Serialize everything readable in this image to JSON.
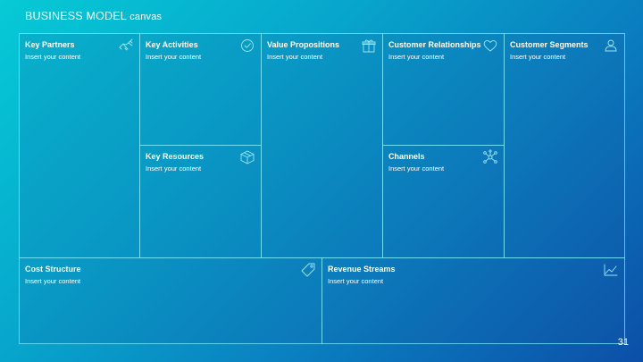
{
  "slide": {
    "title_main": "BUSINESS MODEL",
    "title_rest": " canvas",
    "page_number": "31"
  },
  "cells": {
    "key_partners": {
      "title": "Key Partners",
      "subtitle": "Insert your content",
      "icon": "handshake-icon"
    },
    "key_activities": {
      "title": "Key Activities",
      "subtitle": "Insert your content",
      "icon": "checkmark-icon"
    },
    "key_resources": {
      "title": "Key Resources",
      "subtitle": "Insert your content",
      "icon": "box-icon"
    },
    "value_propositions": {
      "title": "Value Propositions",
      "subtitle": "Insert your content",
      "icon": "gift-icon"
    },
    "customer_relationships": {
      "title": "Customer Relationships",
      "subtitle": "Insert your content",
      "icon": "heart-icon"
    },
    "channels": {
      "title": "Channels",
      "subtitle": "Insert your content",
      "icon": "network-icon"
    },
    "customer_segments": {
      "title": "Customer Segments",
      "subtitle": "Insert your content",
      "icon": "user-icon"
    },
    "cost_structure": {
      "title": "Cost Structure",
      "subtitle": "Insert your content",
      "icon": "price-tag-icon"
    },
    "revenue_streams": {
      "title": "Revenue Streams",
      "subtitle": "Insert your content",
      "icon": "line-chart-icon"
    }
  },
  "colors": {
    "gradient_start": "#06cad6",
    "gradient_end": "#0c4fa8",
    "border": "#78ebff",
    "icon_stroke": "#9ee6f5"
  }
}
